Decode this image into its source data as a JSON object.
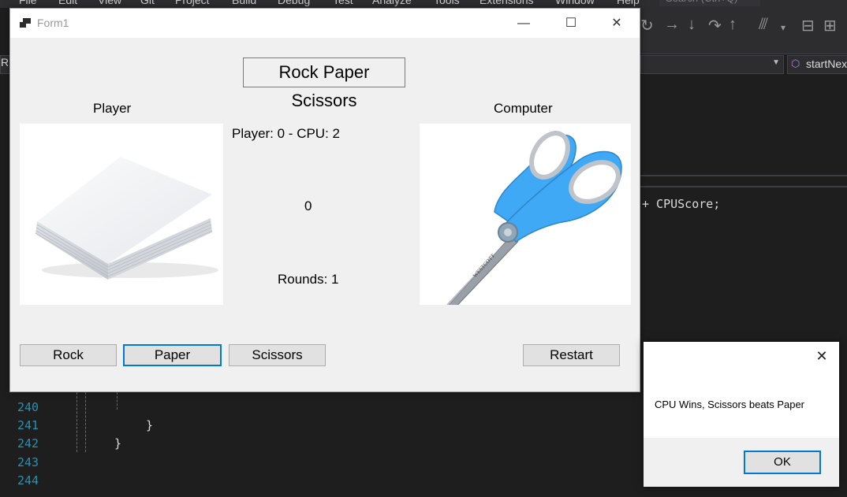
{
  "ide": {
    "menu": [
      "File",
      "Edit",
      "View",
      "Git",
      "Project",
      "Build",
      "Debug",
      "Test",
      "Analyze",
      "Tools",
      "Extensions",
      "Window",
      "Help"
    ],
    "search_placeholder": "Search (Ctrl+Q)",
    "member_dropdown": "startNex",
    "left_dropdown": "R",
    "code_fragment": "+ CPUScore;",
    "line_numbers": [
      "240",
      "241",
      "242",
      "243",
      "244"
    ],
    "line_241": "}",
    "line_242": "}"
  },
  "form": {
    "window_title": "Form1",
    "game_title": "Rock Paper Scissors",
    "player_label": "Player",
    "computer_label": "Computer",
    "score_text": "Player: 0 - CPU: 2",
    "timer_text": "0",
    "rounds_text": "Rounds: 1",
    "player_image": "paper-stack",
    "computer_image": "scissors",
    "buttons": {
      "rock": "Rock",
      "paper": "Paper",
      "scissors": "Scissors",
      "restart": "Restart"
    }
  },
  "message_box": {
    "text": "CPU Wins, Scissors beats Paper",
    "ok_label": "OK"
  },
  "colors": {
    "accent": "#0078d7",
    "ide_background": "#1e1e1e",
    "form_background": "#f0f0f0",
    "scissors_handle": "#3fa9f5"
  }
}
